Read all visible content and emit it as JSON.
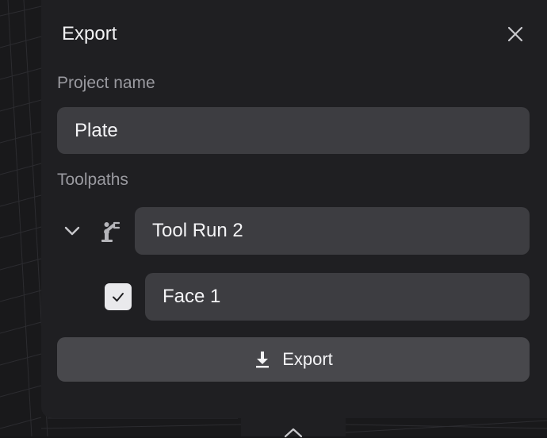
{
  "dialog": {
    "title": "Export",
    "close_icon": "close-icon"
  },
  "project": {
    "label": "Project name",
    "value": "Plate"
  },
  "toolpaths": {
    "label": "Toolpaths",
    "group": {
      "name": "Tool Run 2",
      "expanded": true,
      "icon": "robot-arm-icon",
      "items": [
        {
          "name": "Face 1",
          "checked": true
        }
      ]
    }
  },
  "actions": {
    "export_label": "Export",
    "export_icon": "download-icon"
  },
  "colors": {
    "panel": "#1f1f22",
    "field": "#3d3d41",
    "button": "#48484c",
    "text": "#f4f4f6",
    "muted": "#9a9aa0"
  }
}
